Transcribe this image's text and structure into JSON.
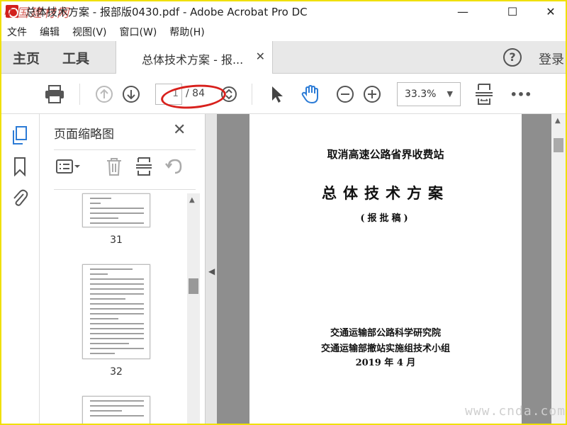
{
  "window": {
    "title": "总体技术方案 - 报部版0430.pdf - Adobe Acrobat Pro DC",
    "watermark_logo": "中国建材网",
    "minimize": "—",
    "maximize": "☐",
    "close": "✕"
  },
  "menu": [
    "文件",
    "编辑",
    "视图(V)",
    "窗口(W)",
    "帮助(H)"
  ],
  "tabs": {
    "home": "主页",
    "tools": "工具",
    "doc": "总体技术方案 - 报...",
    "doc_close": "✕",
    "help": "?",
    "login": "登录"
  },
  "toolbar": {
    "page_current": "1",
    "page_total": "/ 84",
    "zoom": "33.3%",
    "more": "•••",
    "icons": [
      "print-icon",
      "page-up-icon",
      "page-down-icon",
      "page-nav-icon",
      "select-arrow-icon",
      "hand-icon",
      "zoom-out-icon",
      "zoom-in-icon",
      "fit-page-icon"
    ]
  },
  "panel": {
    "title": "页面缩略图",
    "close": "✕",
    "thumbnails": [
      {
        "label": "31"
      },
      {
        "label": "32"
      },
      {
        "label": ""
      }
    ]
  },
  "document": {
    "line1": "取消高速公路省界收费站",
    "title": "总体技术方案",
    "subtitle": "(报批稿)",
    "org1": "交通运输部公路科学研究院",
    "org2": "交通运输部撤站实施组技术小组",
    "date": "2019 年 4 月"
  },
  "watermark_url": "www.cnda.com",
  "colors": {
    "accent_blue": "#2b7bd6",
    "highlight_red": "#d8201c",
    "watermark_yellow": "#f0e000"
  }
}
